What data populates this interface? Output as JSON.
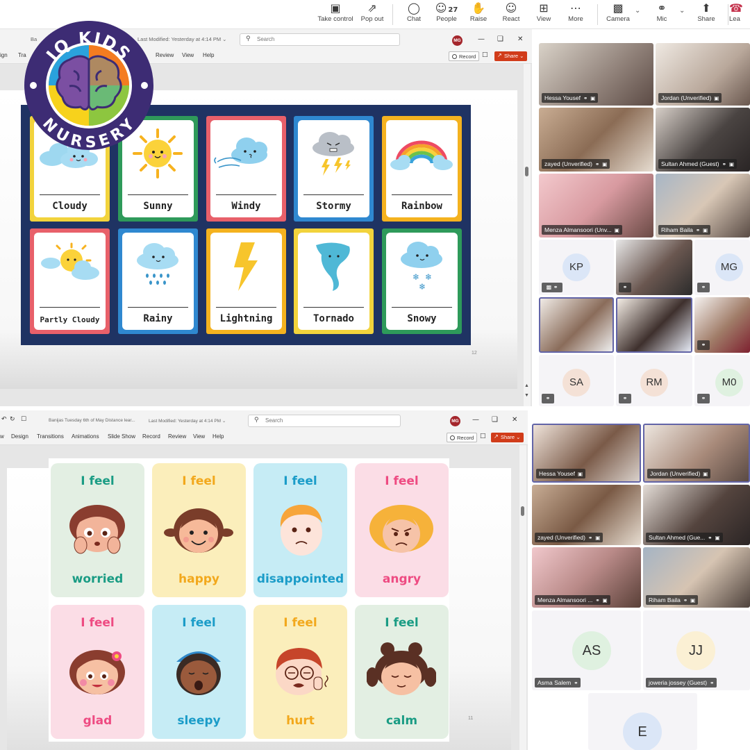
{
  "teams_toolbar": {
    "items": [
      {
        "label": "Take control",
        "icon": "take-control-icon"
      },
      {
        "label": "Pop out",
        "icon": "pop-out-icon"
      },
      {
        "label": "Chat",
        "icon": "chat-icon"
      },
      {
        "label": "People",
        "icon": "people-icon",
        "count": "27"
      },
      {
        "label": "Raise",
        "icon": "raise-hand-icon"
      },
      {
        "label": "React",
        "icon": "react-icon"
      },
      {
        "label": "View",
        "icon": "view-icon"
      },
      {
        "label": "More",
        "icon": "more-icon"
      },
      {
        "label": "Camera",
        "icon": "camera-off-icon"
      },
      {
        "label": "Mic",
        "icon": "mic-off-icon"
      },
      {
        "label": "Share",
        "icon": "share-icon"
      },
      {
        "label": "Lea",
        "icon": "leave-icon"
      }
    ]
  },
  "logo": {
    "top_text": "IQ KIDS",
    "bottom_text": "NURSERY",
    "colors": {
      "ring": "#3d2c74",
      "yellow": "#f7d21c",
      "blue": "#2aa2dd",
      "orange": "#f47c20",
      "green": "#8dc63f",
      "purple": "#7b4fa2"
    }
  },
  "ppt_top": {
    "doc_title_partial": "Ba",
    "last_modified": "Last Modified: Yesterday at 4:14 PM",
    "search_placeholder": "Search",
    "user_initials": "MG",
    "ribbon_tabs": [
      "ign",
      "Tra",
      "Review",
      "View",
      "Help"
    ],
    "record_label": "Record",
    "share_label": "Share",
    "slide_number": "12"
  },
  "weather_cards": [
    {
      "label": "Cloudy",
      "border": "#f2d33c"
    },
    {
      "label": "Sunny",
      "border": "#2e9a5a"
    },
    {
      "label": "Windy",
      "border": "#e8606a"
    },
    {
      "label": "Stormy",
      "border": "#2f88d0"
    },
    {
      "label": "Rainbow",
      "border": "#f4b21f"
    },
    {
      "label": "Partly Cloudy",
      "border": "#e8606a"
    },
    {
      "label": "Rainy",
      "border": "#2f88d0"
    },
    {
      "label": "Lightning",
      "border": "#f4b21f"
    },
    {
      "label": "Tornado",
      "border": "#f2d33c"
    },
    {
      "label": "Snowy",
      "border": "#2e9a5a"
    }
  ],
  "ppt_bottom": {
    "doc_title": "Banijas Tuesday 6th of May Distance lear...",
    "last_modified": "Last Modified: Yesterday at 4:14 PM",
    "search_placeholder": "Search",
    "user_initials": "MG",
    "ribbon_tabs": [
      "w",
      "Design",
      "Transitions",
      "Animations",
      "Slide Show",
      "Record",
      "Review",
      "View",
      "Help"
    ],
    "record_label": "Record",
    "share_label": "Share",
    "slide_number": "11"
  },
  "feeling_cards": [
    {
      "prefix": "I feel",
      "feeling": "worried",
      "bg": "#e3efe3",
      "color": "#1a9c84"
    },
    {
      "prefix": "I feel",
      "feeling": "happy",
      "bg": "#fbeebb",
      "color": "#f2a81c"
    },
    {
      "prefix": "I feel",
      "feeling": "disappointed",
      "bg": "#c6ecf5",
      "color": "#1b9cc8"
    },
    {
      "prefix": "I feel",
      "feeling": "angry",
      "bg": "#fbdde6",
      "color": "#ee4b82"
    },
    {
      "prefix": "I feel",
      "feeling": "glad",
      "bg": "#fbdde6",
      "color": "#ee4b82"
    },
    {
      "prefix": "I feel",
      "feeling": "sleepy",
      "bg": "#c6ecf5",
      "color": "#1b9cc8"
    },
    {
      "prefix": "I feel",
      "feeling": "hurt",
      "bg": "#fbeebb",
      "color": "#f2a81c"
    },
    {
      "prefix": "I feel",
      "feeling": "calm",
      "bg": "#e3efe3",
      "color": "#1a9c84"
    }
  ],
  "gallery_top": {
    "video_tiles": [
      {
        "name": "Hessa Yousef"
      },
      {
        "name": "Jordan (Unverified)"
      },
      {
        "name": "zayed (Unverified)"
      },
      {
        "name": "Sultan Ahmed (Guest)"
      },
      {
        "name": "Menza Almansoori (Unv..."
      },
      {
        "name": "Riham Baila"
      }
    ],
    "initial_tiles": [
      {
        "initials": "KP",
        "color": "#dbe6f7"
      },
      {
        "initials": "MG",
        "color": "#dbe6f7"
      },
      {
        "initials": "SA",
        "color": "#f4e1d6"
      },
      {
        "initials": "RM",
        "color": "#f4e1d6"
      },
      {
        "initials": "M0",
        "color": "#dff1e0"
      }
    ]
  },
  "gallery_bottom": {
    "video_tiles": [
      {
        "name": "Hessa Yousef"
      },
      {
        "name": "Jordan (Unverified)"
      },
      {
        "name": "zayed (Unverified)"
      },
      {
        "name": "Sultan Ahmed (Gue..."
      },
      {
        "name": "Menza Almansoori ..."
      },
      {
        "name": "Riham Baila"
      }
    ],
    "initial_tiles": [
      {
        "initials": "AS",
        "name": "Asma Salem",
        "color": "#dff1e0"
      },
      {
        "initials": "JJ",
        "name": "joweria jossey (Guest)",
        "color": "#fbf0d4"
      },
      {
        "initials": "E",
        "name": "",
        "color": "#dbe6f7"
      }
    ]
  }
}
